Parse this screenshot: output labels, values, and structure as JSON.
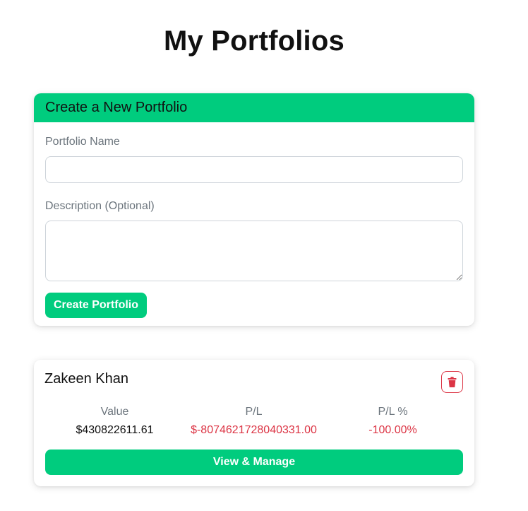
{
  "page": {
    "title": "My Portfolios"
  },
  "create_form": {
    "header": "Create a New Portfolio",
    "name_label": "Portfolio Name",
    "name_value": "",
    "description_label": "Description (Optional)",
    "description_value": "",
    "submit_label": "Create Portfolio"
  },
  "portfolios": [
    {
      "name": "Zakeen Khan",
      "delete_icon": "trash-icon",
      "value_label": "Value",
      "value": "$430822611.61",
      "pl_label": "P/L",
      "pl": "$-8074621728040331.00",
      "pl_pct_label": "P/L %",
      "pl_pct": "-100.00%",
      "view_label": "View & Manage"
    }
  ],
  "colors": {
    "accent": "#00cc7e",
    "danger": "#dc3545",
    "muted": "#6c757d"
  }
}
